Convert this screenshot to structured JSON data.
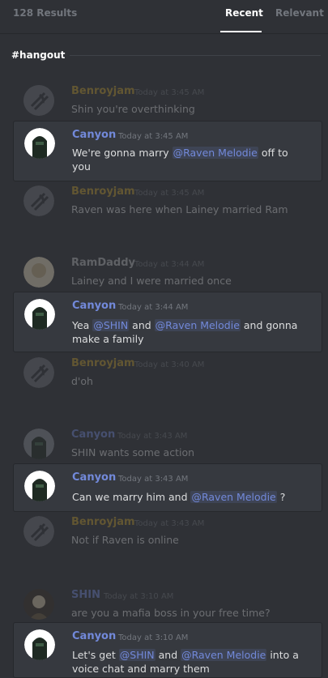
{
  "header": {
    "results": "128 Results",
    "tab_recent": "Recent",
    "tab_relevant": "Relevant"
  },
  "channel": "#hangout",
  "users": {
    "benroyjam": "Benroyjam",
    "canyon": "Canyon",
    "ramdaddy": "RamDaddy",
    "shin": "SHIN"
  },
  "messages": [
    {
      "kind": "context",
      "author": "Benroyjam",
      "time": "Today at 3:45 AM",
      "text": "Shin you're overthinking"
    },
    {
      "kind": "hit",
      "author": "Canyon",
      "time": "Today at 3:45 AM",
      "text_before": "We're gonna marry ",
      "mention1": "@Raven Melodie",
      "text_after": " off to you"
    },
    {
      "kind": "context",
      "author": "Benroyjam",
      "time": "Today at 3:45 AM",
      "text": "Raven was here when Lainey married Ram"
    },
    {
      "kind": "context",
      "author": "RamDaddy",
      "time": "Today at 3:44 AM",
      "text": "Lainey and I were married once"
    },
    {
      "kind": "hit",
      "author": "Canyon",
      "time": "Today at 3:44 AM",
      "text_before": "Yea ",
      "mention1": "@SHIN",
      "text_mid": " and ",
      "mention2": "@Raven Melodie",
      "text_after": " and gonna make a family"
    },
    {
      "kind": "context",
      "author": "Benroyjam",
      "time": "Today at 3:40 AM",
      "text": "d'oh"
    },
    {
      "kind": "context",
      "author": "Canyon",
      "time": "Today at 3:43 AM",
      "text": "SHIN wants some action"
    },
    {
      "kind": "hit",
      "author": "Canyon",
      "time": "Today at 3:43 AM",
      "text_before": "Can we marry him and ",
      "mention1": "@Raven Melodie",
      "text_after": " ?"
    },
    {
      "kind": "context",
      "author": "Benroyjam",
      "time": "Today at 3:43 AM",
      "text": "Not if Raven is online"
    },
    {
      "kind": "context",
      "author": "SHIN",
      "time": "Today at 3:10 AM",
      "text": "are you a mafia boss in your free time?"
    },
    {
      "kind": "hit",
      "author": "Canyon",
      "time": "Today at 3:10 AM",
      "text_before": "Let's get ",
      "mention1": "@SHIN",
      "text_mid": " and ",
      "mention2": "@Raven Melodie",
      "text_after": " into a voice chat and marry them"
    }
  ]
}
